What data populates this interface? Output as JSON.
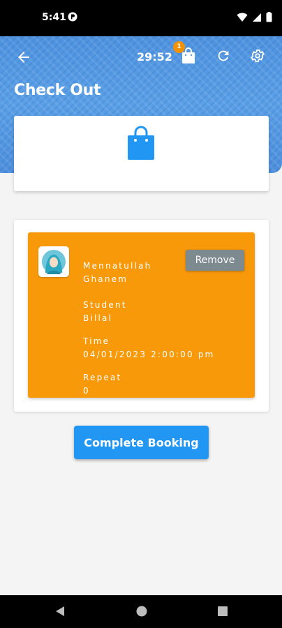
{
  "status_bar": {
    "time": "5:41",
    "icons": [
      "app-notification-icon",
      "wifi-icon",
      "signal-icon",
      "battery-icon"
    ]
  },
  "header": {
    "title": "Check Out",
    "timer": "29:52",
    "cart_count": "1",
    "icons": [
      "back-arrow-icon",
      "shopping-bag-icon",
      "refresh-icon",
      "settings-icon"
    ]
  },
  "booking": {
    "teacher_name_line1": "Mennatullah",
    "teacher_name_line2": "Ghanem",
    "student_label": "Student",
    "student_value": "Billal",
    "time_label": "Time",
    "time_value": "04/01/2023 2:00:00 pm",
    "repeat_label": "Repeat",
    "repeat_value": "0",
    "remove_label": "Remove"
  },
  "actions": {
    "complete_label": "Complete Booking"
  },
  "colors": {
    "header_blue": "#4f93df",
    "booking_orange": "#f8990a",
    "primary_blue": "#2196f3",
    "remove_grey": "#7d8a8f",
    "badge_orange": "#f39200"
  }
}
